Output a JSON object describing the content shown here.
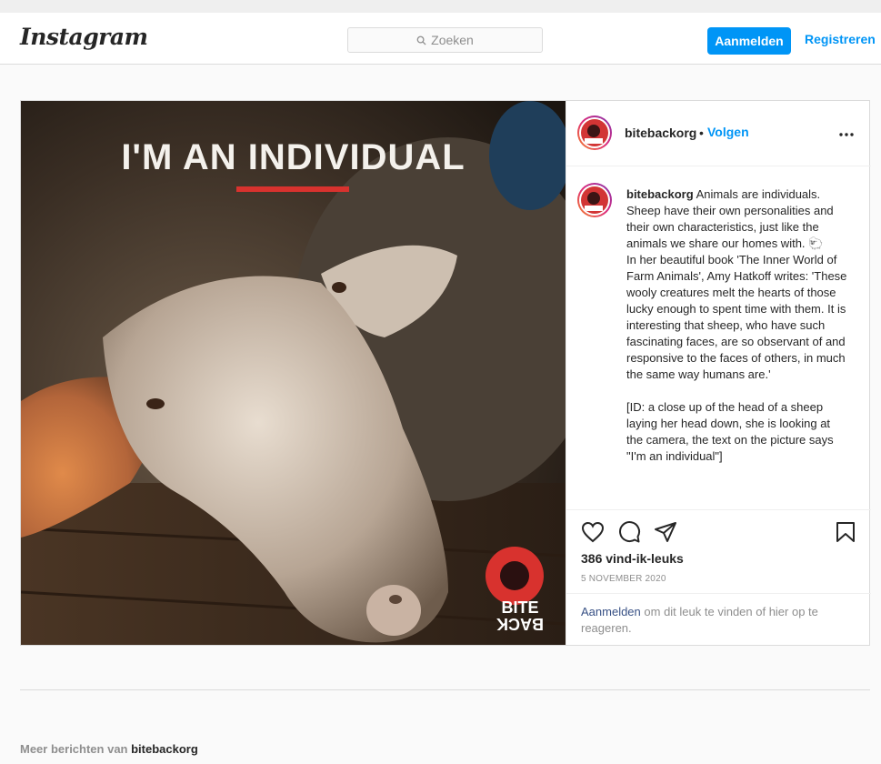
{
  "app": {
    "logo": "Instagram"
  },
  "header": {
    "search_placeholder": "Zoeken",
    "login_label": "Aanmelden",
    "register_label": "Registreren",
    "accent": "#0095f6"
  },
  "post": {
    "image_text": "I'M AN INDIVIDUAL",
    "image_logo_top": "BITE",
    "image_logo_bottom": "BACK",
    "username": "bitebackorg",
    "dot": "•",
    "follow_label": "Volgen",
    "more_icon": "more-horizontal-icon",
    "caption_user": "bitebackorg",
    "caption_body": "Animals are individuals. Sheep have their own personalities and their own characteristics, just like the animals we share our homes with. 🐑\nIn her beautiful book 'The Inner World of Farm Animals', Amy Hatkoff writes: 'These wooly creatures melt the hearts of those lucky enough to spent time with them. It is interesting that sheep, who have such fascinating faces, are so observant of and responsive to the faces of others, in much the same way humans are.'\n\n[ID: a close up of the head of a sheep laying her head down, she is looking at the camera, the text on the picture says \"I'm an individual\"]",
    "likes": "386 vind-ik-leuks",
    "date": "5 NOVEMBER 2020",
    "login_link": "Aanmelden",
    "login_prompt": " om dit leuk te vinden of hier op te reageren."
  },
  "footer": {
    "more_prefix": "Meer berichten van ",
    "more_user": "bitebackorg"
  }
}
